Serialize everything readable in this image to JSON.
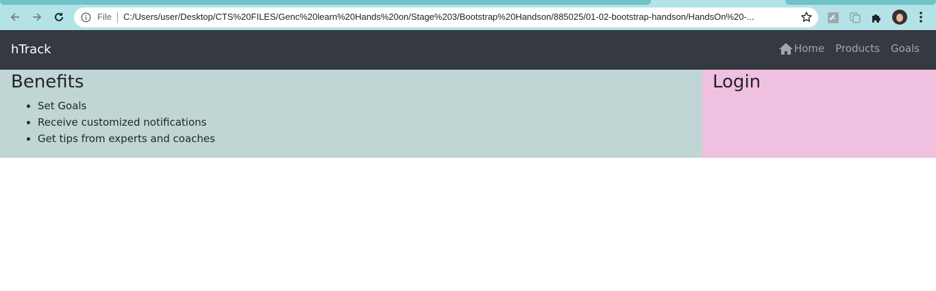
{
  "browser": {
    "url_scheme_label": "File",
    "url": "C:/Users/user/Desktop/CTS%20FILES/Genc%20learn%20Hands%20on/Stage%203/Bootstrap%20Handson/885025/01-02-bootstrap-handson/HandsOn%20-...",
    "icons": [
      "back-icon",
      "forward-icon",
      "reload-icon",
      "info-icon",
      "star-icon",
      "pdf-extension-icon",
      "copy-extension-icon",
      "puzzle-extensions-icon",
      "profile-avatar",
      "kebab-menu-icon"
    ]
  },
  "navbar": {
    "brand": "hTrack",
    "links": [
      {
        "label": "Home",
        "icon": "home-icon"
      },
      {
        "label": "Products"
      },
      {
        "label": "Goals"
      }
    ],
    "colors": {
      "background": "#343a40",
      "brand": "#ffffff",
      "link": "rgba(255,255,255,0.55)"
    }
  },
  "benefits": {
    "title": "Benefits",
    "items": [
      "Set Goals",
      "Receive customized notifications",
      "Get tips from experts and coaches"
    ],
    "background": "#c0d6d5"
  },
  "login": {
    "title": "Login",
    "background": "#f0c0e0"
  }
}
